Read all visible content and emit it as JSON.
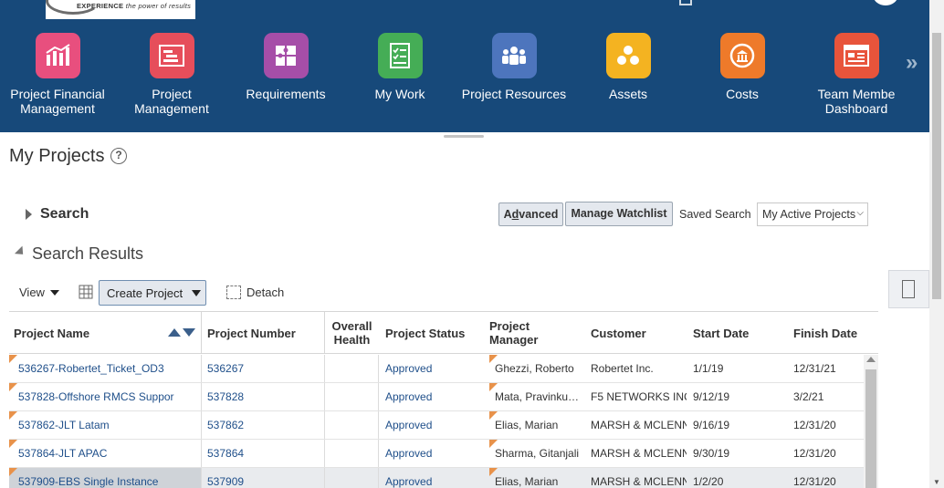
{
  "header": {
    "logo_text_bold": "EXPERIENCE",
    "logo_text": " the power of results",
    "apps": [
      {
        "label_line1": "Project Financial",
        "label_line2": "Management",
        "color": "#e84f7e",
        "icon": "chart-icon"
      },
      {
        "label_line1": "Project",
        "label_line2": "Management",
        "color": "#e64e5b",
        "icon": "gantt-icon"
      },
      {
        "label_line1": "Requirements",
        "label_line2": "",
        "color": "#a64ea8",
        "icon": "puzzle-icon"
      },
      {
        "label_line1": "My Work",
        "label_line2": "",
        "color": "#45ad56",
        "icon": "checklist-icon"
      },
      {
        "label_line1": "Project Resources",
        "label_line2": "",
        "color": "#4d75bd",
        "icon": "people-icon"
      },
      {
        "label_line1": "Assets",
        "label_line2": "",
        "color": "#f4b321",
        "icon": "assets-icon"
      },
      {
        "label_line1": "Costs",
        "label_line2": "",
        "color": "#ee7a2a",
        "icon": "bank-icon"
      },
      {
        "label_line1": "Team Membe",
        "label_line2": "Dashboard",
        "color": "#e8543b",
        "icon": "dashboard-icon"
      }
    ],
    "more": "»"
  },
  "page": {
    "title": "My Projects",
    "help": "?"
  },
  "search": {
    "label": "Search",
    "advanced_prefix": "A",
    "advanced_underline": "d",
    "advanced_suffix": "vanced",
    "manage_watchlist": "Manage Watchlist",
    "saved_search_label": "Saved Search",
    "saved_search_value": "My Active Projects"
  },
  "results": {
    "label": "Search Results",
    "view": "View",
    "create_project": "Create Project",
    "detach": "Detach"
  },
  "table": {
    "headers": {
      "name": "Project Name",
      "number": "Project Number",
      "health_line1": "Overall",
      "health_line2": "Health",
      "status": "Project Status",
      "manager_line1": "Project",
      "manager_line2": "Manager",
      "customer": "Customer",
      "start": "Start Date",
      "finish": "Finish Date"
    },
    "rows": [
      {
        "name": "536267-Robertet_Ticket_OD3",
        "number": "536267",
        "status": "Approved",
        "manager": "Ghezzi, Roberto",
        "customer": "Robertet Inc.",
        "start": "1/1/19",
        "finish": "12/31/21"
      },
      {
        "name": "537828-Offshore RMCS Suppor",
        "number": "537828",
        "status": "Approved",
        "manager": "Mata, Pravinku…",
        "customer": "F5 NETWORKS INC",
        "start": "9/12/19",
        "finish": "3/2/21"
      },
      {
        "name": "537862-JLT Latam",
        "number": "537862",
        "status": "Approved",
        "manager": "Elias, Marian",
        "customer": "MARSH & MCLENNAN",
        "start": "9/16/19",
        "finish": "12/31/20"
      },
      {
        "name": "537864-JLT APAC",
        "number": "537864",
        "status": "Approved",
        "manager": "Sharma, Gitanjali",
        "customer": "MARSH & MCLENNAN",
        "start": "9/30/19",
        "finish": "12/31/20"
      },
      {
        "name": "537909-EBS Single Instance",
        "number": "537909",
        "status": "Approved",
        "manager": "Elias, Marian",
        "customer": "MARSH & MCLENNAN",
        "start": "1/2/20",
        "finish": "12/31/20"
      }
    ]
  }
}
